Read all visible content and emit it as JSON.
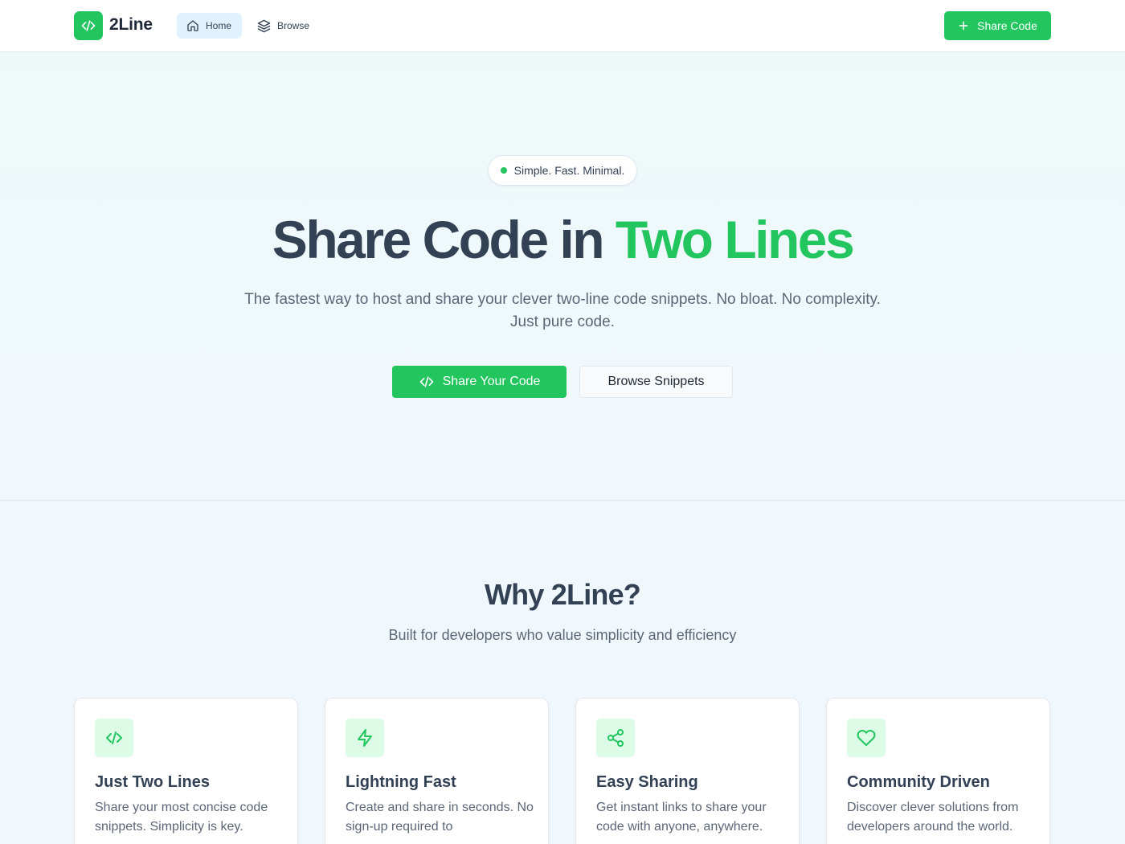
{
  "header": {
    "logo_text": "2Line",
    "nav": [
      {
        "label": "Home",
        "icon": "home-icon",
        "active": true
      },
      {
        "label": "Browse",
        "icon": "layers-icon",
        "active": false
      }
    ],
    "share_button_label": "Share Code"
  },
  "hero": {
    "pill_text": "Simple. Fast. Minimal.",
    "title_main": "Share Code in ",
    "title_accent": "Two Lines",
    "subtitle": "The fastest way to host and share your clever two-line code snippets. No bloat. No complexity. Just pure code.",
    "primary_button": "Share Your Code",
    "secondary_button": "Browse Snippets"
  },
  "features": {
    "title": "Why 2Line?",
    "subtitle": "Built for developers who value simplicity and efficiency",
    "cards": [
      {
        "icon": "code-icon",
        "title": "Just Two Lines",
        "text": "Share your most concise code snippets. Simplicity is key."
      },
      {
        "icon": "lightning-icon",
        "title": "Lightning Fast",
        "text": "Create and share in seconds. No sign-up required to"
      },
      {
        "icon": "share-icon",
        "title": "Easy Sharing",
        "text": "Get instant links to share your code with anyone, anywhere."
      },
      {
        "icon": "heart-icon",
        "title": "Community Driven",
        "text": "Discover clever solutions from developers around the world."
      }
    ]
  },
  "colors": {
    "accent": "#22c55e",
    "text": "#334155",
    "muted": "#5b6677",
    "background": "#f1f8fd"
  }
}
